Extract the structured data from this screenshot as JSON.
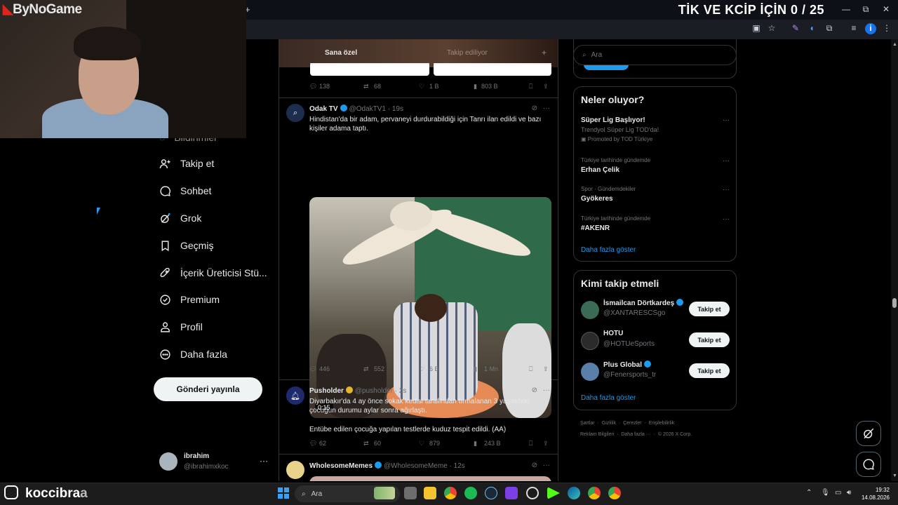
{
  "browser": {
    "new_tab": "+",
    "window_controls": [
      "—",
      "⧉",
      "✕"
    ],
    "overlay_title": "TİK VE KCİP İÇİN 0 / 25"
  },
  "stream": {
    "brand": "ByNoGame",
    "instagram_handle_main": "koccibra",
    "instagram_handle_tail": "a"
  },
  "nav": {
    "partial_top": "Bildirimler",
    "items": [
      {
        "label": "Takip et",
        "icon": "add-user-icon"
      },
      {
        "label": "Sohbet",
        "icon": "chat-icon"
      },
      {
        "label": "Grok",
        "icon": "grok-icon"
      },
      {
        "label": "Geçmiş",
        "icon": "bookmark-icon"
      },
      {
        "label": "İçerik Üreticisi Stü...",
        "icon": "rocket-icon"
      },
      {
        "label": "Premium",
        "icon": "premium-icon"
      },
      {
        "label": "Profil",
        "icon": "profile-icon"
      },
      {
        "label": "Daha fazla",
        "icon": "more-circle-icon"
      }
    ],
    "post_button": "Gönderi yayınla",
    "account": {
      "name": "ibrahim",
      "handle": "@ibrahimxkoc",
      "more": "···"
    }
  },
  "feed": {
    "tabs": [
      "Sana özel",
      "Takip ediliyor"
    ],
    "add_tab": "+",
    "top_stats": {
      "replies": "138",
      "reposts": "68",
      "likes": "1 B",
      "views": "803 B"
    },
    "tweets": [
      {
        "name": "Odak TV",
        "handle": "@OdakTV1",
        "time": "· 19s",
        "text": "Hindistan'da bir adam, pervaneyi durdurabildiği için Tanrı ilan edildi ve bazı kişiler adama taptı.",
        "video_duration": "0:15",
        "stats": {
          "replies": "446",
          "reposts": "552",
          "likes": "6 B",
          "views": "1 Mn"
        }
      },
      {
        "name": "Pusholder",
        "handle": "@pusholder",
        "time": "· 2s",
        "text": "Diyarbakır'da 4 ay önce sokak kedisi tarafından tırmalanan 3 yaşındaki çocuğun durumu aylar sonra ağırlaştı.",
        "text2": "Entübe edilen çocuğa yapılan testlerde kuduz tespit edildi. (AA)",
        "stats": {
          "replies": "62",
          "reposts": "60",
          "likes": "879",
          "views": "243 B"
        }
      },
      {
        "name": "WholesomeMemes",
        "handle": "@WholesomeMeme",
        "time": "· 12s"
      }
    ]
  },
  "sidebar": {
    "search_placeholder": "Ara",
    "trends_title": "Neler oluyor?",
    "trends": [
      {
        "context": "",
        "name": "Süper Lig Başlıyor!",
        "sub": "Trendyol Süper Lig TOD'da!",
        "promo": "Promoted by TOD Türkiye"
      },
      {
        "context": "Türkiye tarihinde gündemde",
        "name": "Erhan Çelik"
      },
      {
        "context": "Spor · Gündemdekiler",
        "name": "Gyökeres"
      },
      {
        "context": "Türkiye tarihinde gündemde",
        "name": "#AKENR"
      }
    ],
    "show_more": "Daha fazla göster",
    "who_title": "Kimi takip etmeli",
    "who": [
      {
        "name": "İsmailcan Dörtkardeş",
        "handle": "@XANTARESCSgo",
        "button": "Takip et",
        "color": "#3b6a55"
      },
      {
        "name": "HOTU",
        "handle": "@HOTUeSports",
        "button": "Takip et",
        "color": "#2b2b2b"
      },
      {
        "name": "Plus Global",
        "handle": "@Fenersports_tr",
        "button": "Takip et",
        "color": "#5a7fa8"
      }
    ],
    "footer_line1": [
      "Şartlar",
      "Gizlilik",
      "Çerezler",
      "Erişilebilirlik"
    ],
    "footer_line2": [
      "Reklam Bilgileri",
      "Daha fazla ···",
      "© 2026 X Corp."
    ]
  },
  "taskbar": {
    "search": "Ara",
    "time": "19:32",
    "date": "14.08.2026"
  }
}
